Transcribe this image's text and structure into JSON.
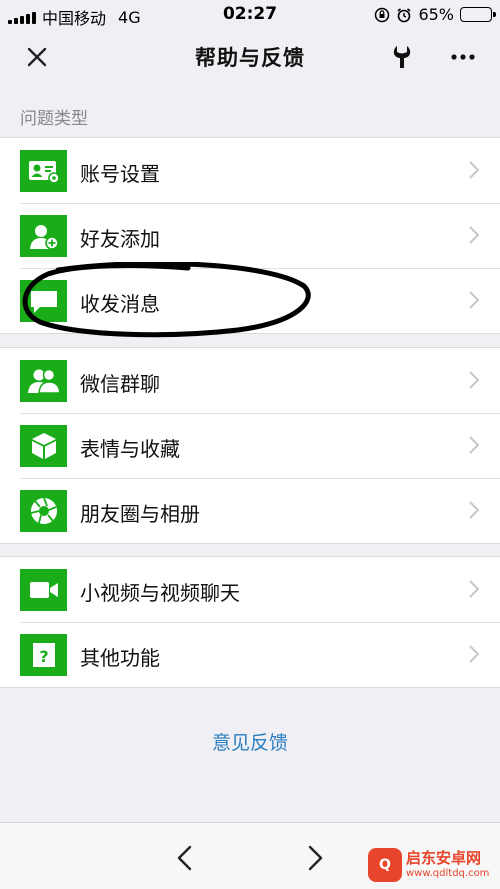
{
  "status_bar": {
    "carrier": "中国移动",
    "network": "4G",
    "time": "02:27",
    "battery_percent": "65%",
    "battery_level": 0.65,
    "icons": [
      "signal-icon",
      "rotation-lock-icon",
      "alarm-icon",
      "battery-icon"
    ]
  },
  "nav": {
    "title": "帮助与反馈",
    "icons": [
      "close-icon",
      "wrench-icon",
      "more-icon"
    ]
  },
  "section": {
    "header": "问题类型"
  },
  "groups": [
    {
      "items": [
        {
          "label": "账号设置",
          "icon": "account-card-icon"
        },
        {
          "label": "好友添加",
          "icon": "add-friend-icon"
        },
        {
          "label": "收发消息",
          "icon": "message-icon"
        }
      ]
    },
    {
      "items": [
        {
          "label": "微信群聊",
          "icon": "group-chat-icon"
        },
        {
          "label": "表情与收藏",
          "icon": "sticker-box-icon"
        },
        {
          "label": "朋友圈与相册",
          "icon": "moments-shutter-icon"
        }
      ]
    },
    {
      "items": [
        {
          "label": "小视频与视频聊天",
          "icon": "video-camera-icon"
        },
        {
          "label": "其他功能",
          "icon": "question-icon"
        }
      ]
    }
  ],
  "feedback": {
    "label": "意见反馈"
  },
  "toolbar": {
    "icons": [
      "back-arrow-icon",
      "forward-arrow-icon"
    ]
  },
  "colors": {
    "accent": "#1aad19",
    "link": "#2a7fc1",
    "background": "#efeff4"
  },
  "watermark": {
    "title": "启东安卓网",
    "url": "www.qdltdq.com"
  }
}
